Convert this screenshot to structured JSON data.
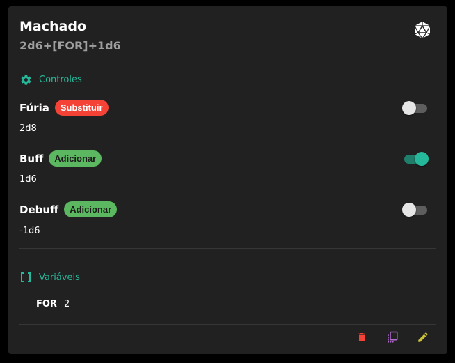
{
  "weapon": {
    "title": "Machado",
    "formula": "2d6+[FOR]+1d6"
  },
  "controls": {
    "header": "Controles",
    "icon": "gear-icon",
    "modifiers": [
      {
        "name": "Fúria",
        "badge": "Substituir",
        "badge_type": "replace",
        "value": "2d8",
        "enabled": false
      },
      {
        "name": "Buff",
        "badge": "Adicionar",
        "badge_type": "add",
        "value": "1d6",
        "enabled": true
      },
      {
        "name": "Debuff",
        "badge": "Adicionar",
        "badge_type": "add",
        "value": "-1d6",
        "enabled": false
      }
    ]
  },
  "variables": {
    "header": "Variáveis",
    "icon": "brackets-icon",
    "items": [
      {
        "name": "FOR",
        "value": "2"
      }
    ]
  },
  "actions": {
    "delete_icon": "trash-icon",
    "copy_icon": "copy-icon",
    "edit_icon": "pencil-icon"
  },
  "colors": {
    "accent": "#26b89a",
    "replace_badge": "#f44336",
    "add_badge": "#5cb860",
    "delete": "#f44336",
    "copy": "#b36ad1",
    "edit": "#c8c23a"
  }
}
